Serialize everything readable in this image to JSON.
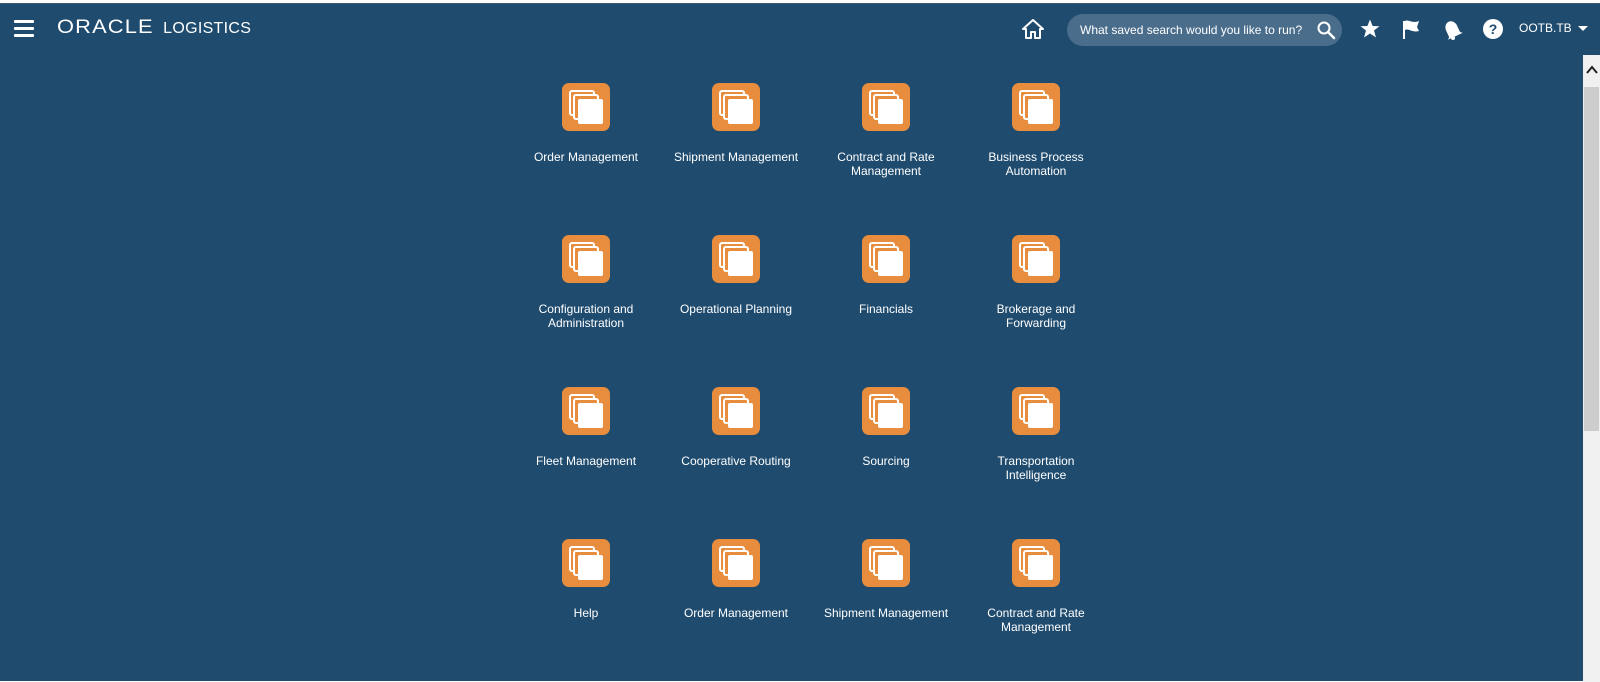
{
  "header": {
    "brand_logo": "ORACLE",
    "brand_product": "LOGISTICS",
    "search_placeholder": "What saved search would you like to run?",
    "user": "OOTB.TB",
    "icons": [
      "menu-icon",
      "home-icon",
      "search-icon",
      "star-icon",
      "flag-icon",
      "bell-icon",
      "help-icon",
      "chevron-down-icon"
    ]
  },
  "tiles": [
    {
      "label": "Order Management",
      "icon": "folder-stack-icon"
    },
    {
      "label": "Shipment Management",
      "icon": "folder-stack-icon"
    },
    {
      "label": "Contract and Rate Management",
      "icon": "folder-stack-icon"
    },
    {
      "label": "Business Process Automation",
      "icon": "folder-stack-icon"
    },
    {
      "label": "Configuration and Administration",
      "icon": "folder-stack-icon"
    },
    {
      "label": "Operational Planning",
      "icon": "folder-stack-icon"
    },
    {
      "label": "Financials",
      "icon": "folder-stack-icon"
    },
    {
      "label": "Brokerage and Forwarding",
      "icon": "folder-stack-icon"
    },
    {
      "label": "Fleet Management",
      "icon": "folder-stack-icon"
    },
    {
      "label": "Cooperative Routing",
      "icon": "folder-stack-icon"
    },
    {
      "label": "Sourcing",
      "icon": "folder-stack-icon"
    },
    {
      "label": "Transportation Intelligence",
      "icon": "folder-stack-icon"
    },
    {
      "label": "Help",
      "icon": "folder-stack-icon"
    },
    {
      "label": "Order Management",
      "icon": "folder-stack-icon"
    },
    {
      "label": "Shipment Management",
      "icon": "folder-stack-icon"
    },
    {
      "label": "Contract and Rate Management",
      "icon": "folder-stack-icon"
    }
  ],
  "colors": {
    "background": "#1f4b6e",
    "tile_icon": "#e88d3e",
    "search_field": "#4a6d8c",
    "text": "#ffffff"
  }
}
